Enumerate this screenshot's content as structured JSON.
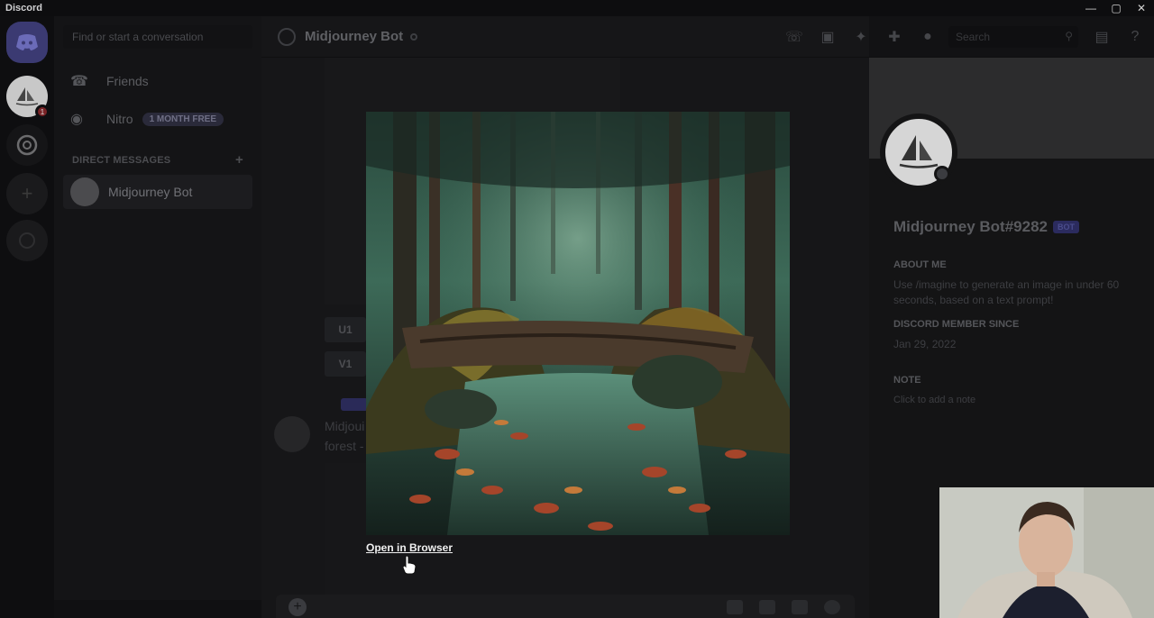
{
  "window": {
    "title": "Discord"
  },
  "dm_sidebar": {
    "search_placeholder": "Find or start a conversation",
    "friends_label": "Friends",
    "nitro_label": "Nitro",
    "nitro_badge": "1 MONTH FREE",
    "section_header": "DIRECT MESSAGES",
    "dm_items": [
      {
        "name": "Midjourney Bot"
      }
    ],
    "guild_badge_count": "1"
  },
  "chat": {
    "channel_title": "Midjourney Bot",
    "search_placeholder": "Search",
    "buttons": [
      "U1",
      "V1"
    ],
    "message_text_line1": "Midjoui",
    "message_text_line2": "forest -"
  },
  "profile": {
    "name": "Midjourney Bot#9282",
    "bot_badge": "BOT",
    "about_header": "ABOUT ME",
    "about_text": "Use /imagine to generate an image in under 60 seconds, based on a text prompt!",
    "member_since_header": "DISCORD MEMBER SINCE",
    "member_since_value": "Jan 29, 2022",
    "note_header": "NOTE",
    "note_placeholder": "Click to add a note"
  },
  "image_preview": {
    "open_link": "Open in Browser"
  },
  "colors": {
    "accent": "#5865f2",
    "background": "#121214"
  }
}
